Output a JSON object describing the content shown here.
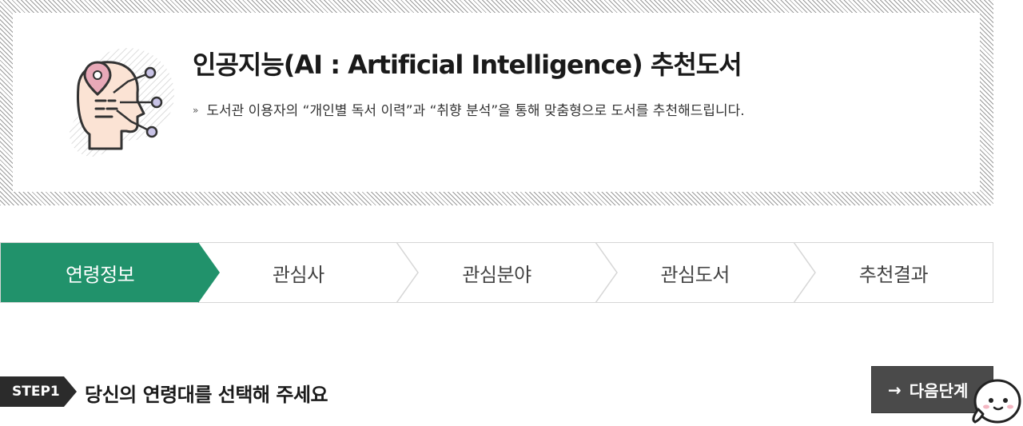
{
  "banner": {
    "title": "인공지능(AI : Artificial Intelligence) 추천도서",
    "description_marker": "»",
    "description": "도서관 이용자의 “개인별 독서 이력”과 “취향 분석”을 통해 맞춤형으로 도서를 추천해드립니다."
  },
  "steps": [
    {
      "label": "연령정보",
      "active": true
    },
    {
      "label": "관심사",
      "active": false
    },
    {
      "label": "관심분야",
      "active": false
    },
    {
      "label": "관심도서",
      "active": false
    },
    {
      "label": "추천결과",
      "active": false
    }
  ],
  "step1": {
    "badge": "STEP1",
    "question": "당신의 연령대를 선택해 주세요"
  },
  "next_button": {
    "arrow": "→",
    "label": "다음단계"
  },
  "colors": {
    "active_step": "#21926b",
    "button_bg": "#4a4a4a",
    "badge_bg": "#2b2b2b"
  },
  "icons": [
    "ai-head-icon",
    "arrow-right-icon",
    "chatbot-icon"
  ]
}
